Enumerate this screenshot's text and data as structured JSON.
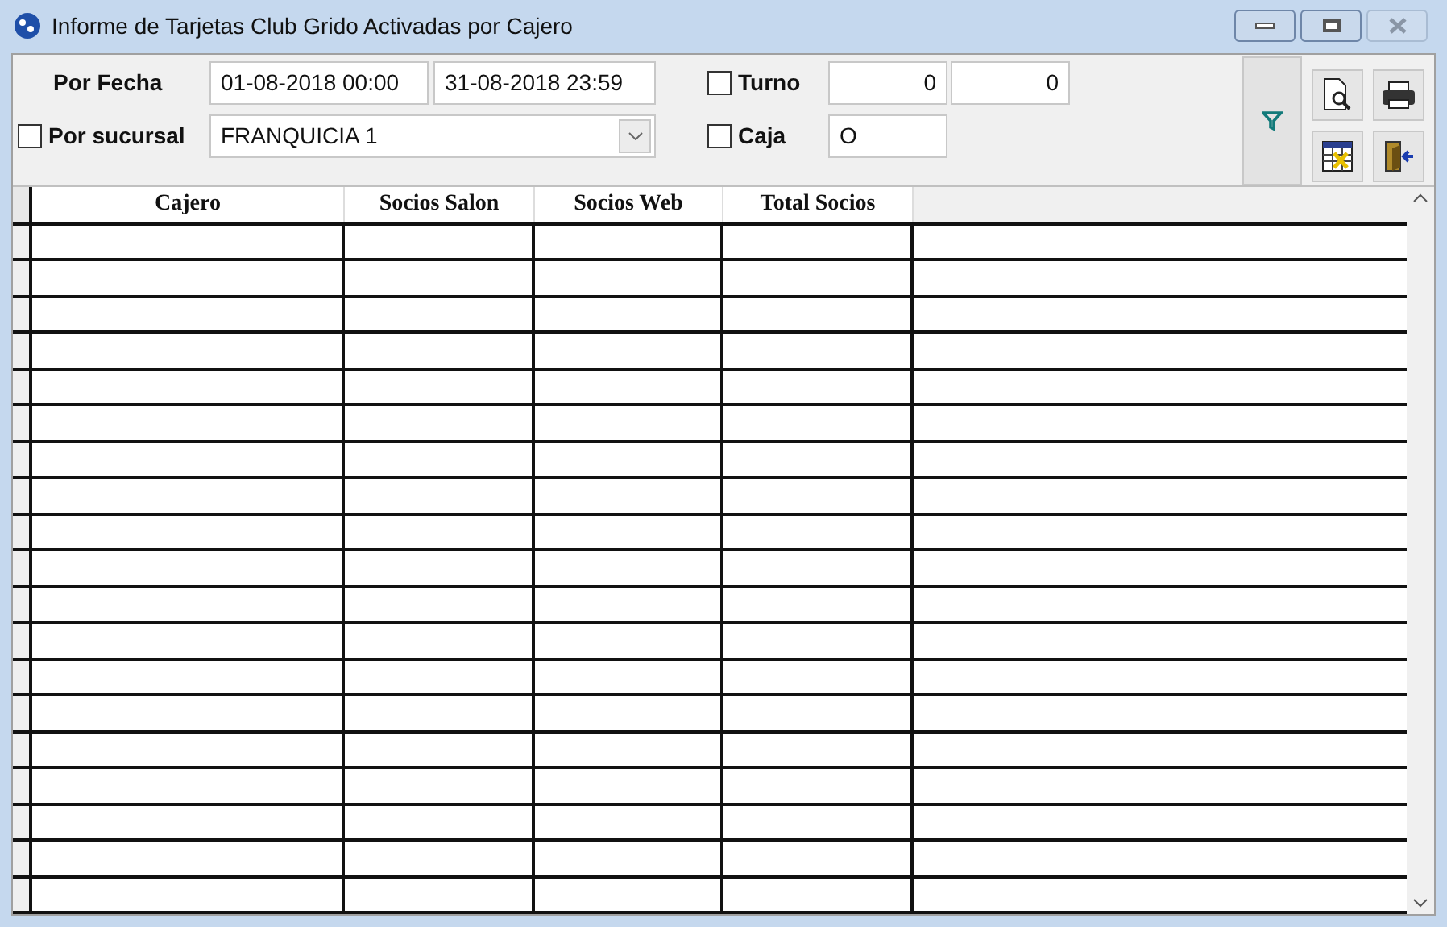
{
  "window": {
    "title": "Informe de Tarjetas Club Grido Activadas por Cajero"
  },
  "filters": {
    "por_fecha": {
      "label": "Por Fecha",
      "from": "01-08-2018 00:00",
      "to": "31-08-2018 23:59"
    },
    "por_sucursal": {
      "label": "Por sucursal",
      "checked": false,
      "value": "FRANQUICIA 1"
    },
    "turno": {
      "label": "Turno",
      "checked": false,
      "from": "0",
      "to": "0"
    },
    "caja": {
      "label": "Caja",
      "checked": false,
      "value": "O"
    }
  },
  "table": {
    "columns": [
      "Cajero",
      "Socios Salon",
      "Socios Web",
      "Total Socios"
    ]
  }
}
